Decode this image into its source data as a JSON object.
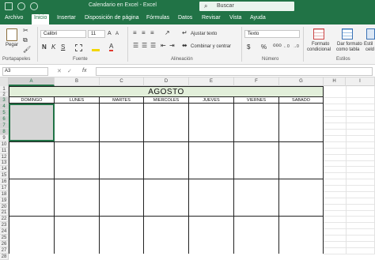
{
  "title": {
    "text": "Calendario en Excel  -  Excel"
  },
  "search": {
    "label": "Buscar"
  },
  "tabs": [
    "Archivo",
    "Inicio",
    "Insertar",
    "Disposición de página",
    "Fórmulas",
    "Datos",
    "Revisar",
    "Vista",
    "Ayuda"
  ],
  "ribbon": {
    "paste_label": "Pegar",
    "font_name": "Calibri",
    "font_size": "11",
    "wrap_text": "Ajustar texto",
    "merge_center": "Combinar y centrar",
    "number_format": "Texto",
    "conditional_format_line1": "Formato",
    "conditional_format_line2": "condicional",
    "table_format_line1": "Dar formato",
    "table_format_line2": "como tabla",
    "cell_styles_line1": "Estil",
    "cell_styles_line2": "celd",
    "groups": {
      "clipboard": "Portapapeles",
      "font": "Fuente",
      "alignment": "Alineación",
      "number": "Número",
      "styles": "Estilos"
    }
  },
  "formula_bar": {
    "name_box": "A3",
    "fx": "fx",
    "value": ""
  },
  "columns": [
    "A",
    "B",
    "C",
    "D",
    "E",
    "F",
    "G",
    "H",
    "I"
  ],
  "rows": [
    "1",
    "2",
    "3",
    "4",
    "5",
    "6",
    "7",
    "8",
    "9",
    "10",
    "11",
    "12",
    "13",
    "14",
    "15",
    "16",
    "17",
    "18",
    "19",
    "20",
    "21",
    "22",
    "23",
    "24",
    "25",
    "26",
    "27",
    "28"
  ],
  "calendar": {
    "month": "AGOSTO",
    "days": [
      "DOMINGO",
      "LUNES",
      "MARTES",
      "MIERCOLES",
      "JUEVES",
      "VIERNES",
      "SABADO"
    ]
  }
}
